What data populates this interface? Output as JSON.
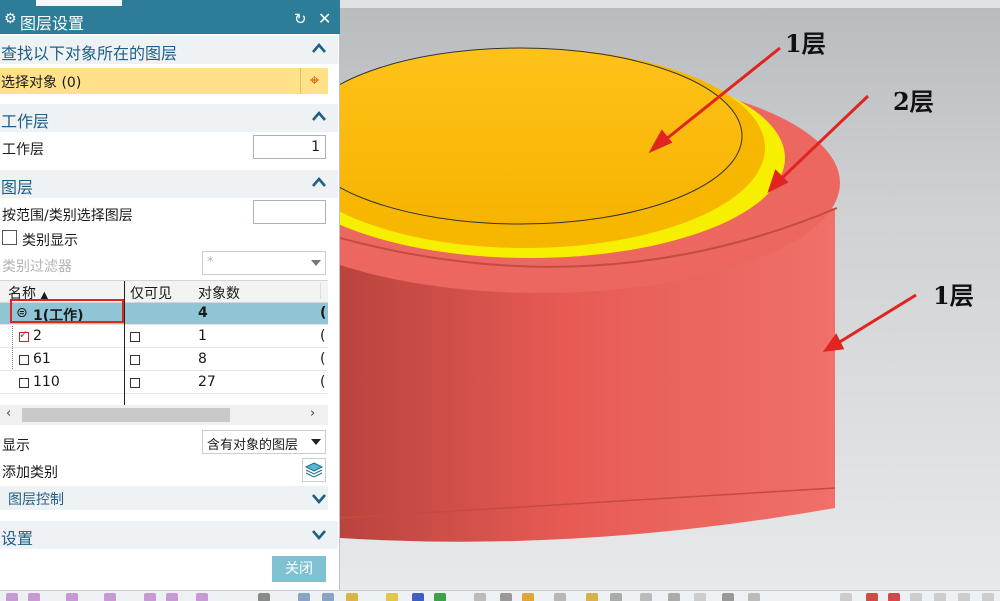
{
  "dialog": {
    "title": "图层设置",
    "find_section": {
      "title": "查找以下对象所在的图层",
      "select_label": "选择对象 (0)"
    },
    "work_layer_section": {
      "title": "工作层",
      "label": "工作层",
      "value": "1"
    },
    "layers_section": {
      "title": "图层",
      "range_label": "按范围/类别选择图层",
      "category_display_label": "类别显示",
      "category_filter_label": "类别过滤器",
      "category_filter_value": "*",
      "table": {
        "headers": [
          "名称",
          "仅可见",
          "对象数"
        ],
        "rows": [
          {
            "name": "1(工作)",
            "count": "4"
          },
          {
            "name": "2",
            "count": "1"
          },
          {
            "name": "61",
            "count": "8"
          },
          {
            "name": "110",
            "count": "27"
          }
        ]
      },
      "show_label": "显示",
      "show_value": "含有对象的图层",
      "add_category_label": "添加类别",
      "layer_control_label": "图层控制"
    },
    "settings_section": {
      "title": "设置"
    },
    "close_button": "关闭"
  },
  "viewport": {
    "callouts": {
      "top": "1层",
      "middle": "2层",
      "right": "1层"
    }
  },
  "colors": {
    "title_bar": "#2d7d99",
    "section_text": "#1f5f85",
    "selection_highlight": "#ffe18a",
    "selected_row": "#90c5d6",
    "annotation_red": "#e0241f",
    "layer1_red": "#e8605a",
    "layer2_yellow": "#f6ef00",
    "top_orange": "#ffbd00"
  }
}
